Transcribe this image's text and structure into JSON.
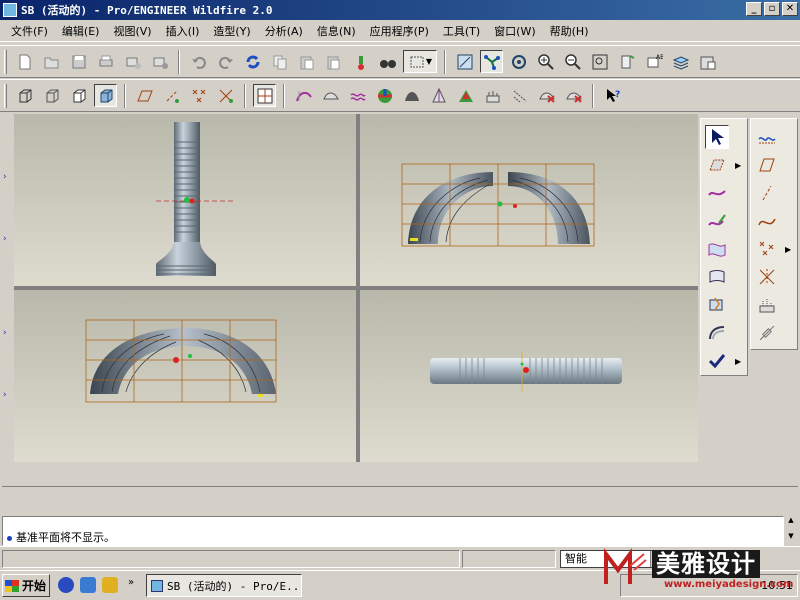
{
  "window": {
    "title": "SB (活动的) - Pro/ENGINEER Wildfire 2.0",
    "minimize": "_",
    "restore": "▫",
    "close": "✕"
  },
  "menu": [
    {
      "label": "文件(F)"
    },
    {
      "label": "编辑(E)"
    },
    {
      "label": "视图(V)"
    },
    {
      "label": "插入(I)"
    },
    {
      "label": "造型(Y)"
    },
    {
      "label": "分析(A)"
    },
    {
      "label": "信息(N)"
    },
    {
      "label": "应用程序(P)"
    },
    {
      "label": "工具(T)"
    },
    {
      "label": "窗口(W)"
    },
    {
      "label": "帮助(H)"
    }
  ],
  "toolbar_primary": {
    "icons": [
      "new-icon",
      "open-icon",
      "save-icon",
      "print-icon",
      "email-icon",
      "email-link-icon",
      "undo-icon",
      "redo-icon",
      "regenerate-icon",
      "copy-icon",
      "paste-icon",
      "paste-special-icon",
      "find-icon",
      "binoculars-icon",
      "selection-box-icon",
      "view-repaint-icon",
      "spin-center-icon",
      "orient-icon",
      "zoom-in-icon",
      "zoom-out-icon",
      "refit-icon",
      "named-view-icon",
      "layers-icon",
      "view-manager-icon"
    ]
  },
  "toolbar_secondary": {
    "icons": [
      "wireframe-icon",
      "hidden-line-icon",
      "no-hidden-icon",
      "shading-icon",
      "datum-plane-icon",
      "datum-axis-icon",
      "datum-point-icon",
      "csys-icon",
      "grid-icon",
      "curve-analysis-icon",
      "surface-analysis-icon",
      "curvature-icon",
      "reflection-icon",
      "draft-analysis-icon",
      "slope-icon",
      "dihedral-icon",
      "offset-icon",
      "deviation-icon",
      "delete-analysis-icon",
      "hide-analysis-icon",
      "context-help-icon"
    ]
  },
  "style_panel": {
    "icons": [
      "select-arrow-icon",
      "set-active-plane-icon",
      "curve-icon",
      "edit-curve-icon",
      "boundary-surface-icon",
      "curve-network-icon",
      "trim-surface-icon",
      "connect-surface-icon",
      "done-check-icon"
    ]
  },
  "datum_panel": {
    "icons": [
      "sketch-curve-icon",
      "datum-plane-tool-icon",
      "datum-axis-tool-icon",
      "datum-curve-icon",
      "datum-point-tool-icon",
      "csys-tool-icon",
      "analysis-tool-icon",
      "coordinate-tool-icon"
    ]
  },
  "messages": {
    "line": "基准平面将不显示。"
  },
  "statusbar": {
    "filter": "智能"
  },
  "taskbar": {
    "start": "开始",
    "task_title": "SB (活动的) - Pro/E...",
    "clock": "10:51"
  },
  "watermark": {
    "brand": "美雅设计",
    "url": "www.meiyadesign.com"
  },
  "colors": {
    "titlebar": "#0a246a",
    "viewport_top": "#b8b8ab",
    "viewport_bottom": "#dedccf",
    "grid_lines": "#b0661a",
    "model": "#7d8a95",
    "origin": "#e02020"
  }
}
